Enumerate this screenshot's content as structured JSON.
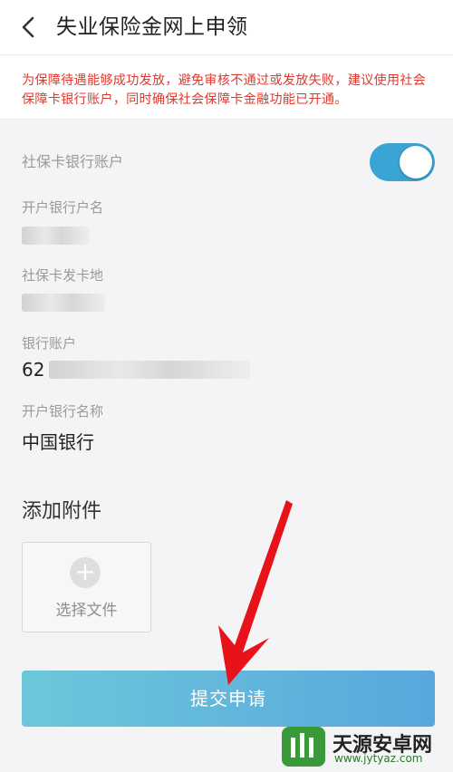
{
  "header": {
    "title": "失业保险金网上申领",
    "back_icon": "chevron-left-icon"
  },
  "notice": {
    "text": "为保障待遇能够成功发放，避免审核不通过或发放失败，建议使用社会保障卡银行账户，同时确保社会保障卡金融功能已开通。",
    "color": "#e03a2f"
  },
  "form": {
    "social_card_account_label": "社保卡银行账户",
    "toggle_on": true,
    "account_name_label": "开户银行户名",
    "card_issue_place_label": "社保卡发卡地",
    "bank_account_label": "银行账户",
    "bank_account_prefix": "62",
    "bank_name_label": "开户银行名称",
    "bank_name_value": "中国银行"
  },
  "attachments": {
    "title": "添加附件",
    "choose_file_label": "选择文件",
    "plus_glyph": "+"
  },
  "submit": {
    "label": "提交申请"
  },
  "watermark": {
    "text": "天源安卓网",
    "url": "www.jytyaz.com"
  },
  "colors": {
    "toggle": "#3aa5d4",
    "submit_start": "#6dc7d9",
    "submit_end": "#58a7de"
  }
}
